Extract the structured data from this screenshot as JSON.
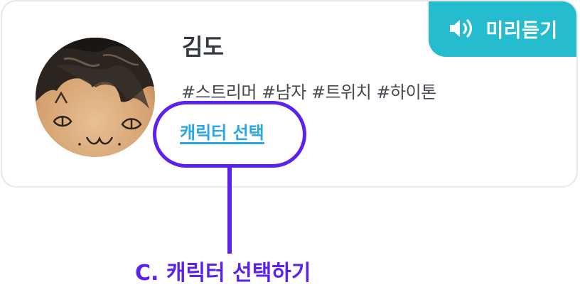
{
  "card": {
    "preview_button": {
      "icon": "speaker-icon",
      "label": "미리듣기"
    },
    "avatar": {
      "icon": "character-avatar-image"
    },
    "name": "김도",
    "tags": "#스트리머 #남자 #트위치 #하이톤",
    "select_link": "캐릭터 선택"
  },
  "callout": {
    "label": "C. 캐릭터 선택하기"
  },
  "colors": {
    "accent_teal": "#25bccf",
    "highlight_purple": "#5b22ee",
    "link_blue": "#2aa6e5",
    "text_dark": "#333842"
  }
}
